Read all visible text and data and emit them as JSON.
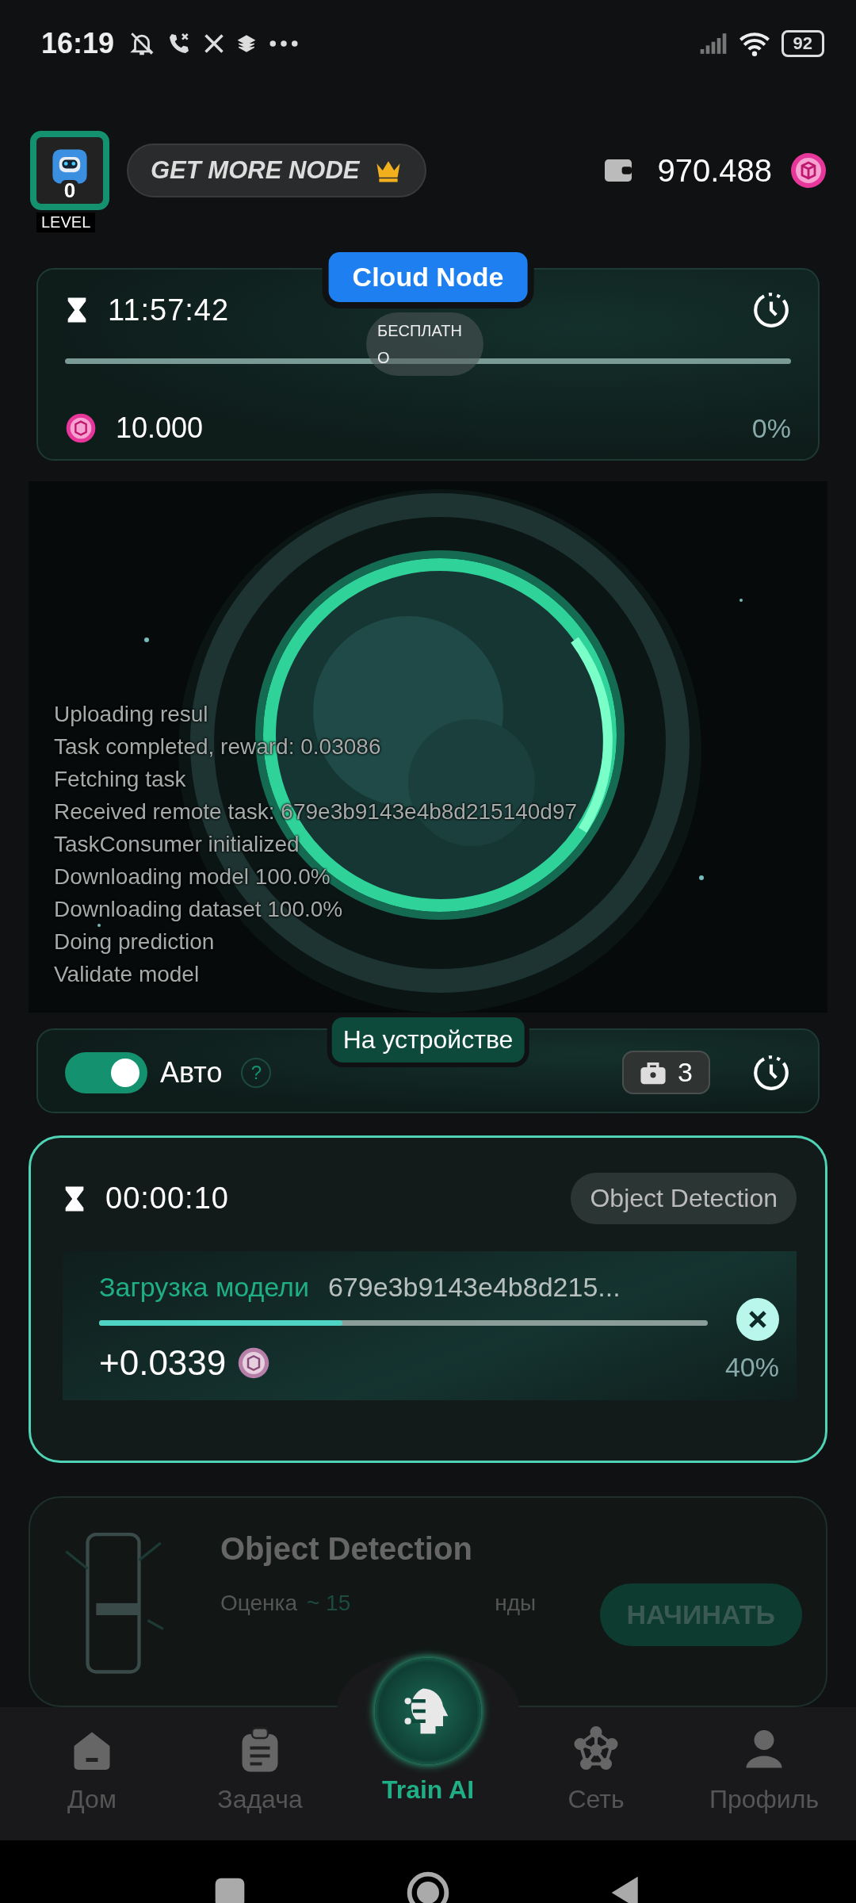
{
  "status_bar": {
    "time": "16:19",
    "battery": "92"
  },
  "header": {
    "level": "0",
    "level_label": "LEVEL",
    "promo_button": "GET MORE NODE",
    "balance": "970.488"
  },
  "cloud_node": {
    "tab": "Cloud Node",
    "timer": "11:57:42",
    "badge": "БЕСПЛАТНО",
    "level": 0,
    "reward": "10.000",
    "percent": "0%"
  },
  "log": [
    "Uploading resul",
    "Task completed, reward: 0.03086",
    "Fetching task",
    "Received remote task: 679e3b9143e4b8d215140d97",
    "TaskConsumer initialized",
    "Downloading model 100.0%",
    "Downloading dataset 100.0%",
    "Doing prediction",
    "Validate model"
  ],
  "device_panel": {
    "tab": "На устройстве",
    "auto_label": "Авто",
    "auto_on": true,
    "help": "?",
    "jobs_count": "3"
  },
  "task": {
    "timer": "00:00:10",
    "category": "Object Detection",
    "stage": "Загрузка модели",
    "task_id": "679e3b9143e4b8d215...",
    "level": 0.4,
    "reward": "+0.0339",
    "percent": "40%"
  },
  "next_task": {
    "title": "Object Detection",
    "estimate_label": "Оценка",
    "estimate_value": "~ 15",
    "estimate_tail": "нды",
    "button": "НАЧИНАТЬ"
  },
  "nav": [
    {
      "label": "Дом",
      "kind": "home",
      "selected": false
    },
    {
      "label": "Задача",
      "kind": "tasks",
      "selected": false
    },
    {
      "label": "Train AI",
      "kind": "train",
      "selected": true
    },
    {
      "label": "Сеть",
      "kind": "network",
      "selected": false
    },
    {
      "label": "Профиль",
      "kind": "profile",
      "selected": false
    }
  ]
}
